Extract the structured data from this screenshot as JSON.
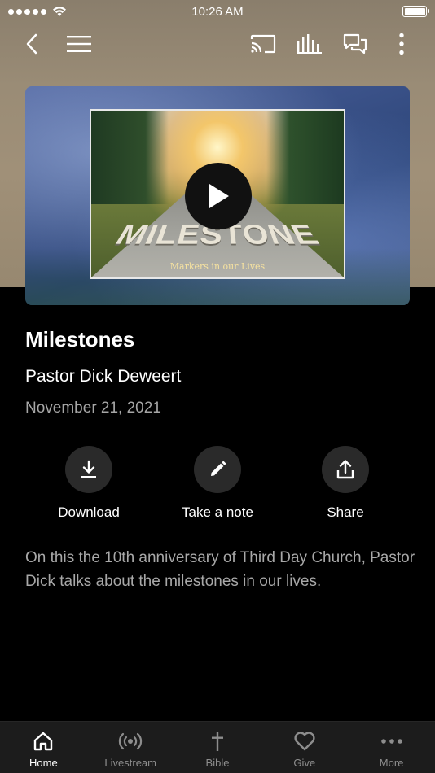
{
  "status_bar": {
    "time": "10:26 AM",
    "battery_level": 1.0
  },
  "nav": {
    "icons": [
      "back-icon",
      "menu-icon",
      "cast-icon",
      "audio-bars-icon",
      "chat-icon",
      "more-vertical-icon"
    ]
  },
  "media": {
    "thumbnail_title": "MILESTONE",
    "thumbnail_subtitle": "Markers in our Lives"
  },
  "sermon": {
    "title": "Milestones",
    "speaker": "Pastor Dick Deweert",
    "date": "November 21, 2021",
    "description": "On this the 10th anniversary of Third Day Church, Pastor Dick talks about the milestones in our lives."
  },
  "actions": [
    {
      "label": "Download",
      "icon": "download-icon"
    },
    {
      "label": "Take a note",
      "icon": "pencil-icon"
    },
    {
      "label": "Share",
      "icon": "share-icon"
    }
  ],
  "tabs": [
    {
      "label": "Home",
      "icon": "home-icon",
      "active": true
    },
    {
      "label": "Livestream",
      "icon": "broadcast-icon",
      "active": false
    },
    {
      "label": "Bible",
      "icon": "cross-icon",
      "active": false
    },
    {
      "label": "Give",
      "icon": "heart-icon",
      "active": false
    },
    {
      "label": "More",
      "icon": "more-horizontal-icon",
      "active": false
    }
  ],
  "colors": {
    "background": "#000000",
    "tab_bar": "#1c1c1c",
    "action_circle": "#2a2a2a",
    "muted_text": "#a6a6a6"
  }
}
